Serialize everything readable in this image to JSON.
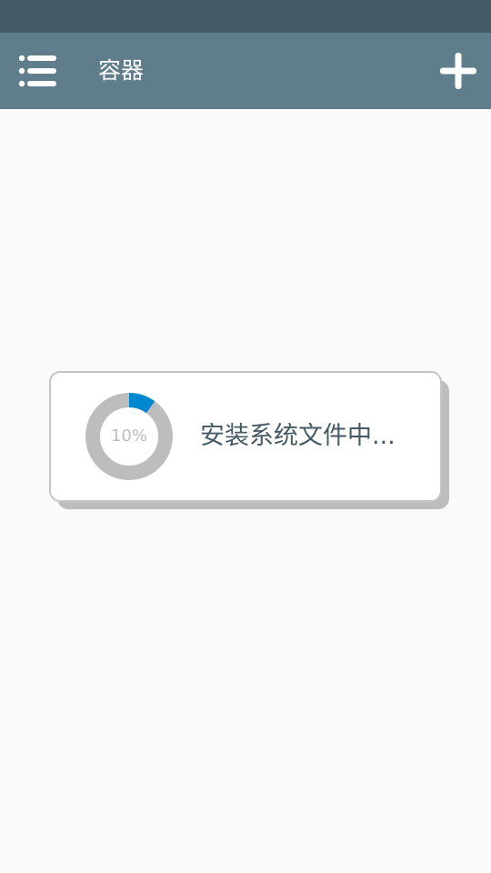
{
  "status_bar": {
    "color": "#455a64"
  },
  "app_bar": {
    "title": "容器",
    "menu_icon": "list-menu-icon",
    "add_icon": "plus-icon",
    "color": "#607d8b"
  },
  "loading_dialog": {
    "progress_text": "10%",
    "progress_fraction": 0.1,
    "message": "安装系统文件中...",
    "accent_color": "#0288d1",
    "track_color": "#bdbdbd"
  }
}
